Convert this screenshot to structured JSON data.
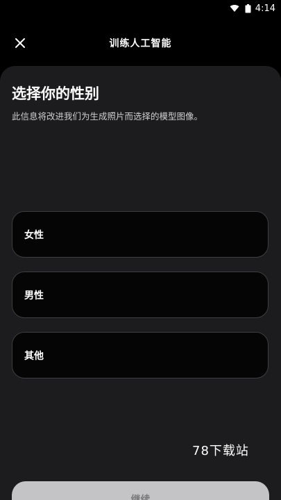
{
  "status_bar": {
    "time": "4:14",
    "icons": [
      "wifi-icon",
      "battery-icon"
    ]
  },
  "app_bar": {
    "title": "训练人工智能",
    "close_icon": "close-icon"
  },
  "content": {
    "heading": "选择你的性别",
    "subheading": "此信息将改进我们为生成照片而选择的模型图像。"
  },
  "options": [
    {
      "label": "女性"
    },
    {
      "label": "男性"
    },
    {
      "label": "其他"
    }
  ],
  "watermark": "78下载站",
  "continue_button": {
    "label": "继续"
  },
  "colors": {
    "background": "#000000",
    "sheet": "#1c1c1e",
    "option_border": "#3e3e42",
    "button_disabled": "#c4c4c6"
  }
}
